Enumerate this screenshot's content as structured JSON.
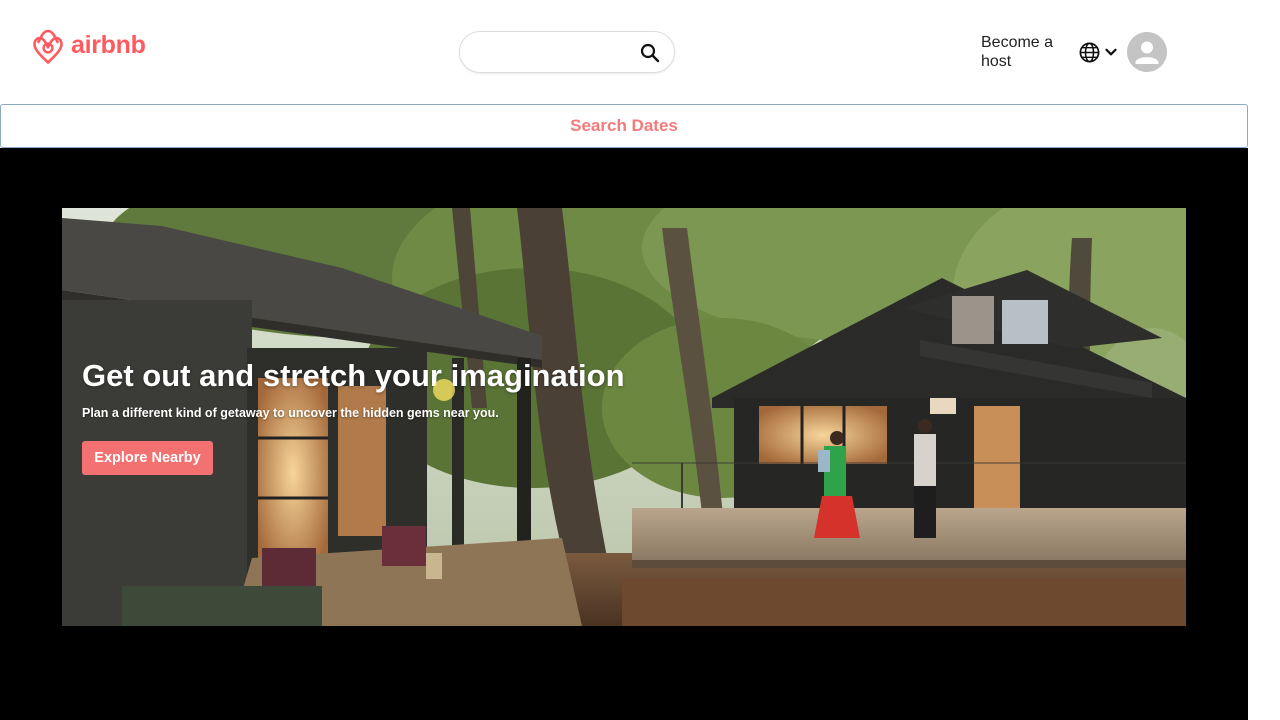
{
  "brand": {
    "name": "airbnb",
    "color": "#ff5a5f",
    "logo_icon": "airbnb-belo-icon"
  },
  "header": {
    "search": {
      "value": "",
      "placeholder": "",
      "button_icon": "search-icon"
    },
    "become_host_label": "Become a host",
    "language_icon": "globe-icon",
    "language_dropdown_icon": "chevron-down-icon",
    "avatar_icon": "user-avatar-icon"
  },
  "dates_bar": {
    "label": "Search Dates",
    "label_color": "#f47b7b"
  },
  "hero": {
    "title": "Get out and stretch your imagination",
    "subtitle": "Plan a different kind of getaway to uncover the hidden gems near you.",
    "cta_label": "Explore Nearby",
    "cta_color": "#f47171",
    "background_color": "#000000",
    "image_description_icon": "cabin-forest-photo"
  }
}
